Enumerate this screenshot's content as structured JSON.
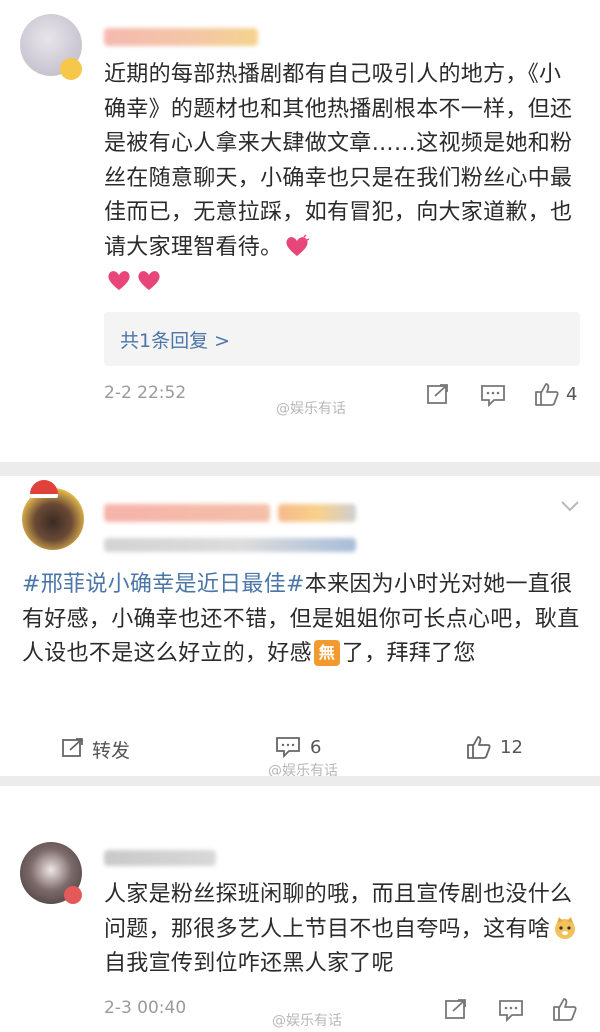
{
  "comments": [
    {
      "text": "近期的每部热播剧都有自己吸引人的地方，《小确幸》的题材也和其他热播剧根本不一样，但还是被有心人拿来大肆做文章……这视频是她和粉丝在随意聊天，小确幸也只是在我们粉丝心中最佳而已，无意拉踩，如有冒犯，向大家道歉，也请大家理智看待。",
      "reply_link": "共1条回复 >",
      "time": "2-2 22:52",
      "likes": "4",
      "watermark": "@娱乐有话"
    },
    {
      "hashtag": "#邢菲说小确幸是近日最佳#",
      "text_before": "本来因为小时光对她一直很有好感，小确幸也还不错，但是姐姐你可长点心吧，耿直人设也不是这么好立的，好感",
      "badge": "無",
      "text_after": "了，拜拜了您",
      "repost_label": "转发",
      "comments_count": "6",
      "likes": "12",
      "watermark": "@娱乐有话"
    },
    {
      "text_before": "人家是粉丝探班闲聊的哦，而且宣传剧也没什么问题，那很多艺人上节目不也自夸吗，这有啥",
      "text_after": "自我宣传到位咋还黑人家了呢",
      "time": "2-3 00:40",
      "watermark": "@娱乐有话"
    }
  ],
  "colors": {
    "link": "#4a76a8",
    "separator": "#ececec",
    "heart": "#e8457a"
  }
}
